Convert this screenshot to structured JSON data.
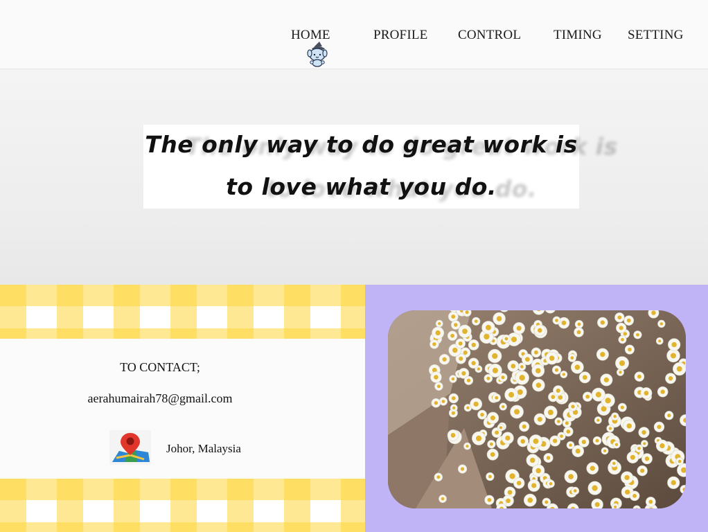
{
  "nav": {
    "home": "HOME",
    "profile": "PROFILE",
    "control": "CONTROL",
    "timing": "TIMING",
    "setting": "SETTING"
  },
  "hero": {
    "quote_line1": "The only way to do great work is",
    "quote_line2": "to love what you do."
  },
  "contact": {
    "title": "TO CONTACT;",
    "email": "aerahumairah78@gmail.com",
    "location": "Johor, Malaysia"
  },
  "icons": {
    "mascot": "mascot-icon",
    "map": "map-pin-icon"
  },
  "colors": {
    "photo_panel_bg": "#c0b4f7",
    "gingham_yellow": "#ffd63c"
  }
}
